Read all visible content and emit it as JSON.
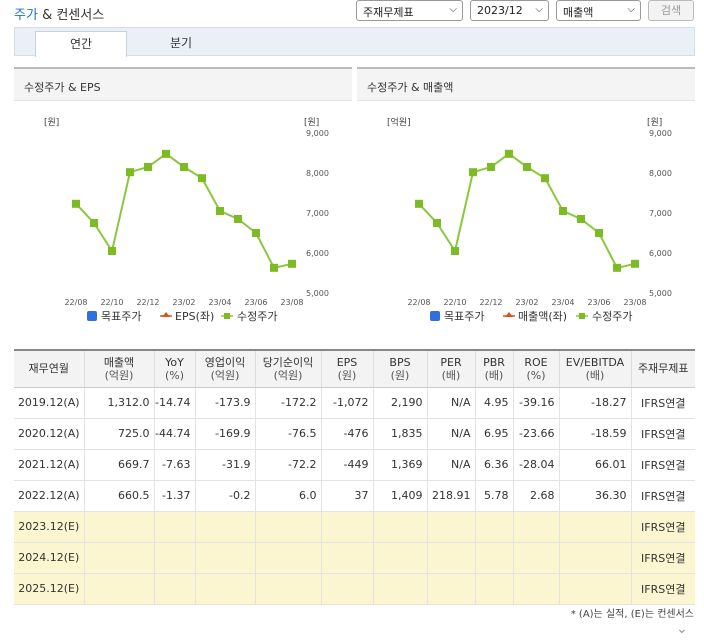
{
  "header": {
    "title_part1": "주가",
    "title_part2": "& 컨센서스",
    "select_basis": "주재무제표",
    "select_period": "2023/12",
    "select_metric": "매출액",
    "search_label": "검색"
  },
  "tabs": [
    {
      "label": "연간",
      "active": true
    },
    {
      "label": "분기",
      "active": false
    }
  ],
  "colors": {
    "price_line": "#8cc63f",
    "price_marker": "#7dbb25",
    "target": "#2f6fde",
    "eps": "#d9531e"
  },
  "chart_data": [
    {
      "type": "line",
      "title": "수정주가 & EPS",
      "left_unit": "[원]",
      "right_unit": "[원]",
      "x": [
        "22/08",
        "22/09",
        "22/10",
        "22/11",
        "22/12",
        "23/01",
        "23/02",
        "23/03",
        "23/04",
        "23/05",
        "23/06",
        "23/07",
        "23/08"
      ],
      "xtick_labels": [
        "22/08",
        "22/10",
        "22/12",
        "23/02",
        "23/04",
        "23/06",
        "23/08"
      ],
      "right_ticks": [
        "9,000",
        "8,000",
        "7,000",
        "6,000",
        "5,000"
      ],
      "ylim": [
        5000,
        9000
      ],
      "series": [
        {
          "name": "수정주가",
          "values": [
            7230,
            6750,
            6050,
            8020,
            8150,
            8480,
            8150,
            7870,
            7050,
            6850,
            6500,
            5630,
            5730
          ]
        }
      ],
      "legend": [
        "목표주가",
        "EPS(좌)",
        "수정주가"
      ]
    },
    {
      "type": "line",
      "title": "수정주가 & 매출액",
      "left_unit": "[억원]",
      "right_unit": "[원]",
      "x": [
        "22/08",
        "22/09",
        "22/10",
        "22/11",
        "22/12",
        "23/01",
        "23/02",
        "23/03",
        "23/04",
        "23/05",
        "23/06",
        "23/07",
        "23/08"
      ],
      "xtick_labels": [
        "22/08",
        "22/10",
        "22/12",
        "23/02",
        "23/04",
        "23/06",
        "23/08"
      ],
      "right_ticks": [
        "9,000",
        "8,000",
        "7,000",
        "6,000",
        "5,000"
      ],
      "ylim": [
        5000,
        9000
      ],
      "series": [
        {
          "name": "수정주가",
          "values": [
            7230,
            6750,
            6050,
            8020,
            8150,
            8480,
            8150,
            7870,
            7050,
            6850,
            6500,
            5630,
            5730
          ]
        }
      ],
      "legend": [
        "목표주가",
        "매출액(좌)",
        "수정주가"
      ]
    }
  ],
  "table": {
    "headers": [
      {
        "label": "재무연월",
        "unit": ""
      },
      {
        "label": "매출액",
        "unit": "(억원)"
      },
      {
        "label": "YoY",
        "unit": "(%)"
      },
      {
        "label": "영업이익",
        "unit": "(억원)"
      },
      {
        "label": "당기순이익",
        "unit": "(억원)"
      },
      {
        "label": "EPS",
        "unit": "(원)"
      },
      {
        "label": "BPS",
        "unit": "(원)"
      },
      {
        "label": "PER",
        "unit": "(배)"
      },
      {
        "label": "PBR",
        "unit": "(배)"
      },
      {
        "label": "ROE",
        "unit": "(%)"
      },
      {
        "label": "EV/EBITDA",
        "unit": "(배)"
      },
      {
        "label": "주재무제표",
        "unit": ""
      }
    ],
    "rows": [
      {
        "cells": [
          "2019.12(A)",
          "1,312.0",
          "-14.74",
          "-173.9",
          "-172.2",
          "-1,072",
          "2,190",
          "N/A",
          "4.95",
          "-39.16",
          "-18.27",
          "IFRS연결"
        ],
        "estimate": false
      },
      {
        "cells": [
          "2020.12(A)",
          "725.0",
          "-44.74",
          "-169.9",
          "-76.5",
          "-476",
          "1,835",
          "N/A",
          "6.95",
          "-23.66",
          "-18.59",
          "IFRS연결"
        ],
        "estimate": false
      },
      {
        "cells": [
          "2021.12(A)",
          "669.7",
          "-7.63",
          "-31.9",
          "-72.2",
          "-449",
          "1,369",
          "N/A",
          "6.36",
          "-28.04",
          "66.01",
          "IFRS연결"
        ],
        "estimate": false
      },
      {
        "cells": [
          "2022.12(A)",
          "660.5",
          "-1.37",
          "-0.2",
          "6.0",
          "37",
          "1,409",
          "218.91",
          "5.78",
          "2.68",
          "36.30",
          "IFRS연결"
        ],
        "estimate": false
      },
      {
        "cells": [
          "2023.12(E)",
          "",
          "",
          "",
          "",
          "",
          "",
          "",
          "",
          "",
          "",
          "IFRS연결"
        ],
        "estimate": true
      },
      {
        "cells": [
          "2024.12(E)",
          "",
          "",
          "",
          "",
          "",
          "",
          "",
          "",
          "",
          "",
          "IFRS연결"
        ],
        "estimate": true
      },
      {
        "cells": [
          "2025.12(E)",
          "",
          "",
          "",
          "",
          "",
          "",
          "",
          "",
          "",
          "",
          "IFRS연결"
        ],
        "estimate": true
      }
    ]
  },
  "footnote": "* (A)는 실적, (E)는 컨센서스"
}
